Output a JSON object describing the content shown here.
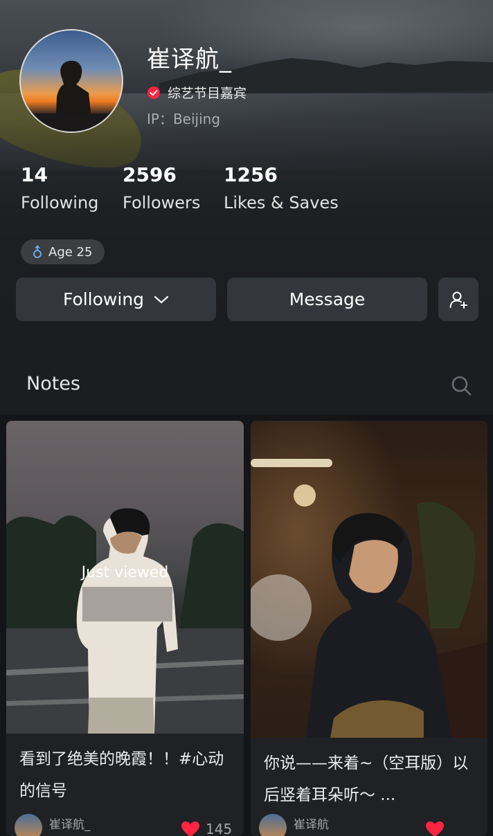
{
  "profile": {
    "username": "崔译航_",
    "verified_title": "综艺节目嘉宾",
    "ip_location": "IP：Beijing",
    "age_tag": "Age 25",
    "colors": {
      "verify_badge": "#ff2442",
      "background": "#141518",
      "button_bg": "#33373b"
    }
  },
  "stats": [
    {
      "value": "14",
      "label": "Following"
    },
    {
      "value": "2596",
      "label": "Followers"
    },
    {
      "value": "1256",
      "label": "Likes & Saves"
    }
  ],
  "actions": {
    "following_label": "Following",
    "message_label": "Message"
  },
  "notes": {
    "section_title": "Notes",
    "cards": [
      {
        "overlay": "Just viewed",
        "title": "看到了绝美的晚霞！！#心动的信号",
        "author": "崔译航_",
        "likes": "145"
      },
      {
        "title": "你说——来着~（空耳版）以后竖着耳朵听～ ...",
        "author": "崔译航"
      }
    ]
  }
}
